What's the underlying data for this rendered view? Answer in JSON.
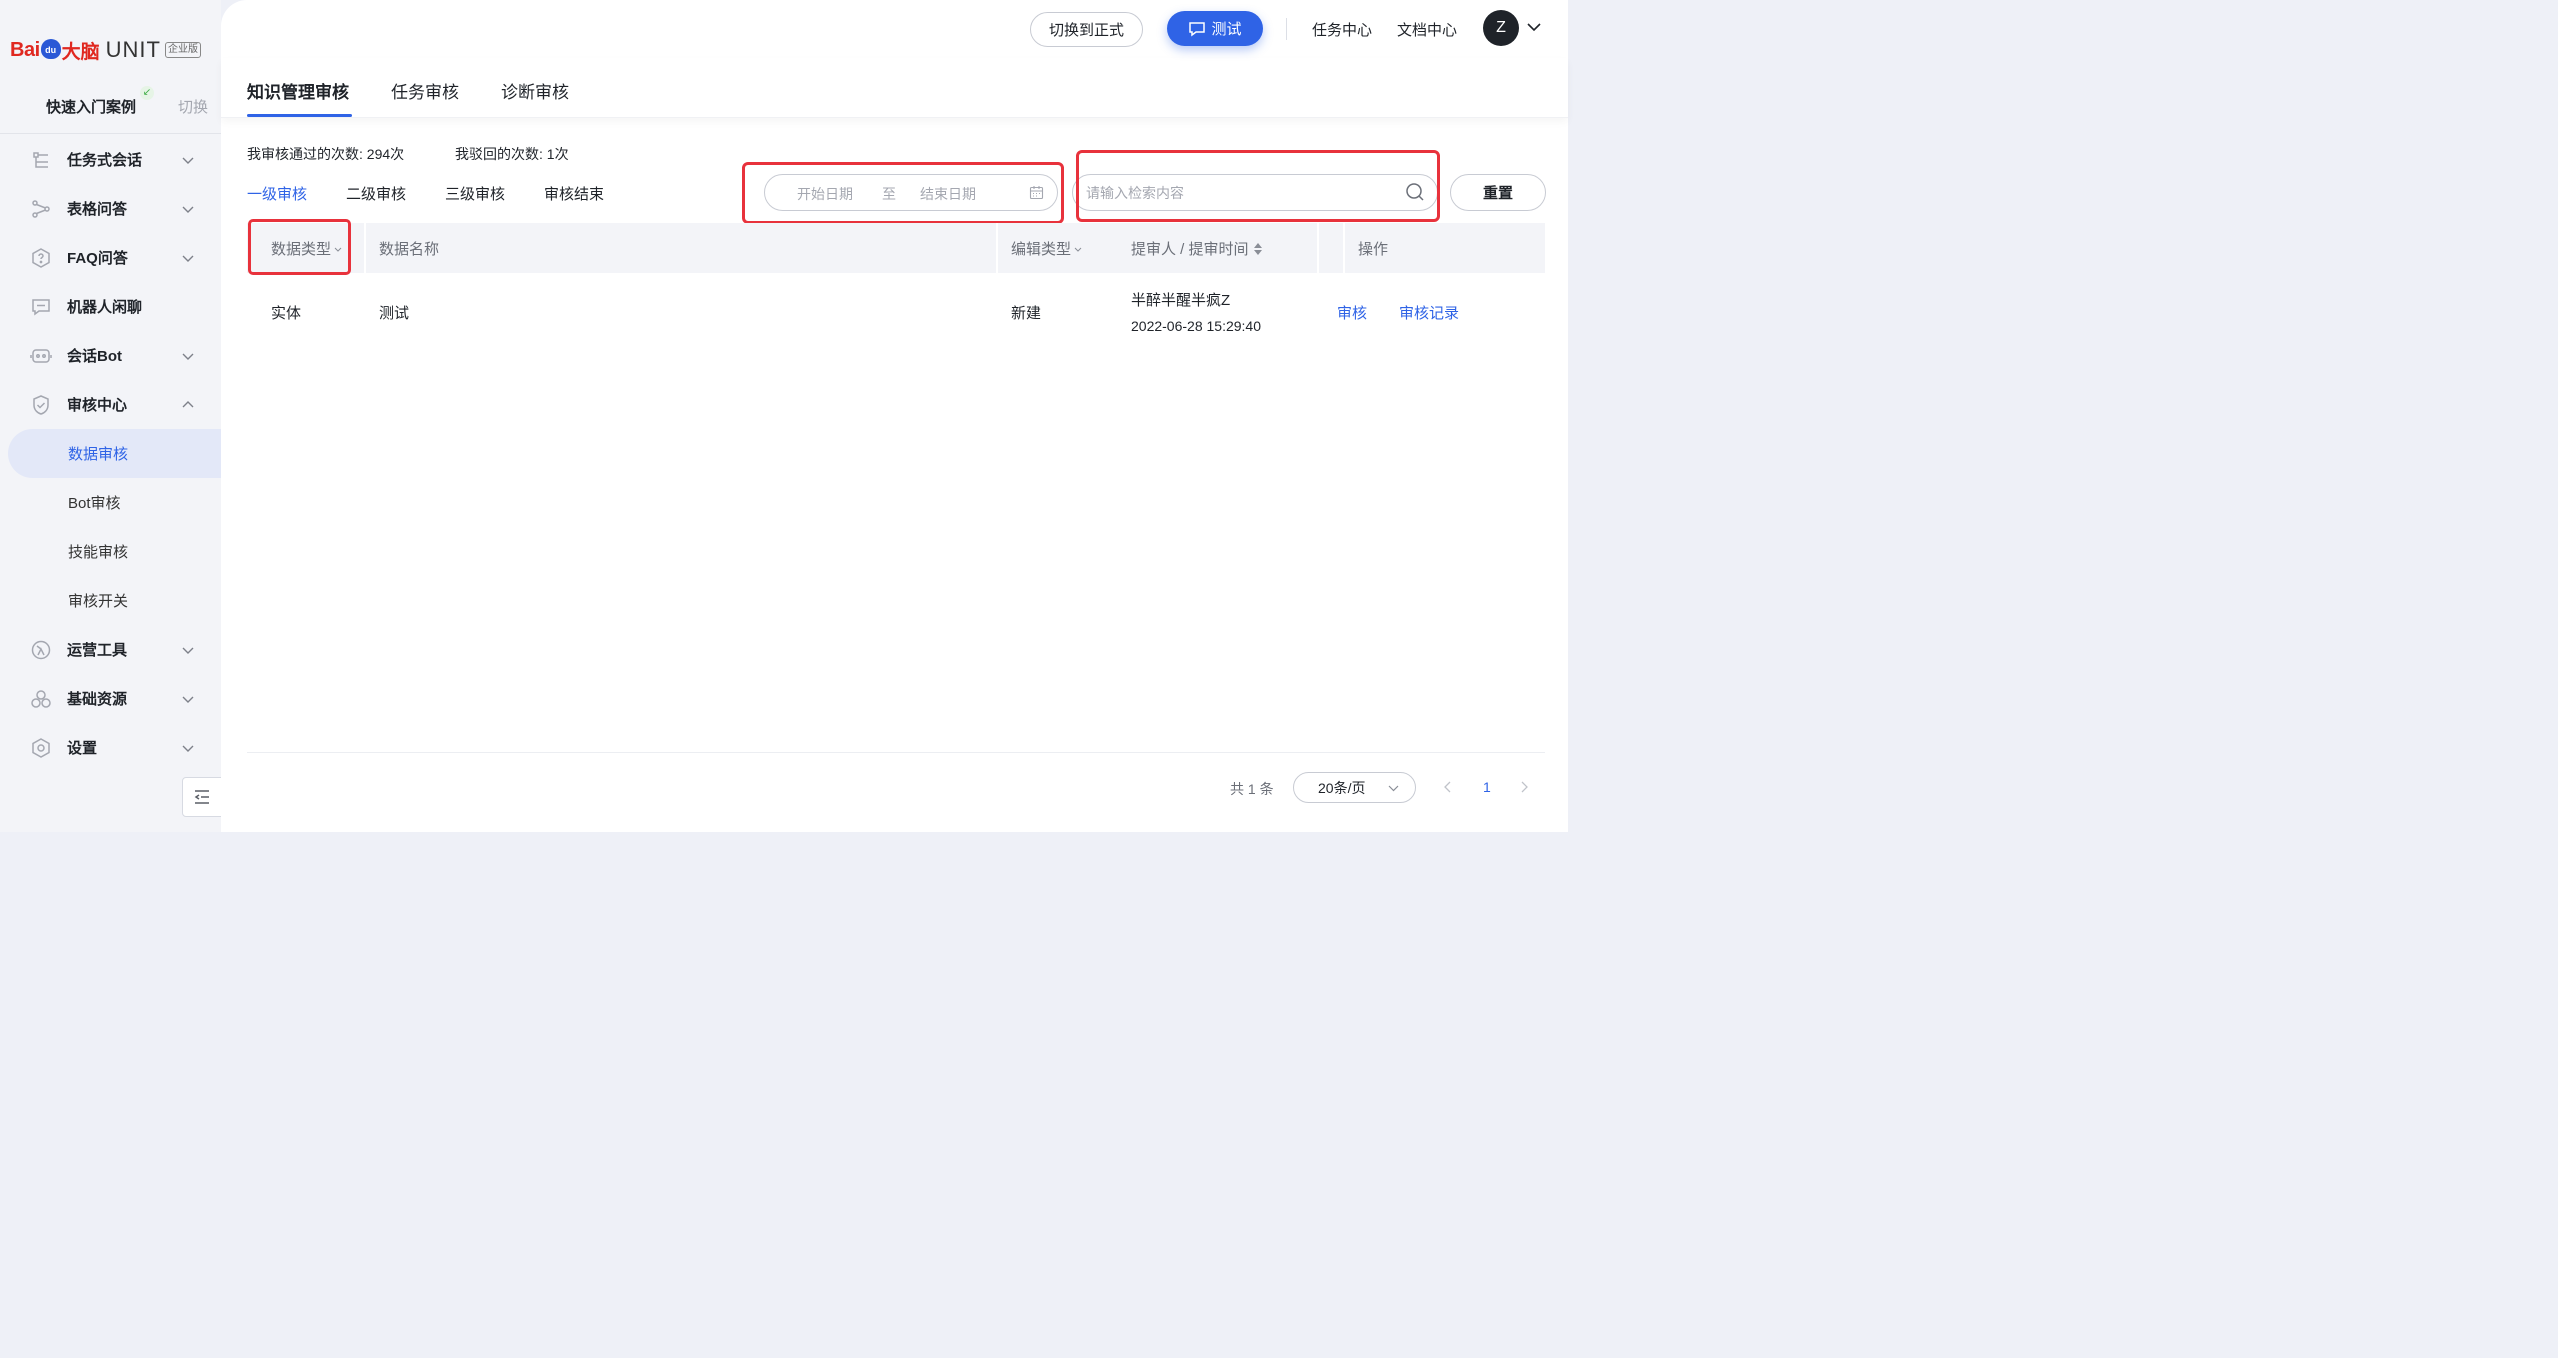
{
  "brand": {
    "baidu": "Bai",
    "du": "du",
    "danao": "大脑",
    "unit": "UNIT",
    "edition": "企业版"
  },
  "sidebar": {
    "case_label": "快速入门案例",
    "switch_label": "切换",
    "items": [
      {
        "label": "任务式会话",
        "icon": "task-dialog-icon",
        "expanded": false
      },
      {
        "label": "表格问答",
        "icon": "table-qa-icon",
        "expanded": false
      },
      {
        "label": "FAQ问答",
        "icon": "faq-icon",
        "expanded": false
      },
      {
        "label": "机器人闲聊",
        "icon": "chat-icon"
      },
      {
        "label": "会话Bot",
        "icon": "bot-icon",
        "expanded": false
      },
      {
        "label": "审核中心",
        "icon": "shield-icon",
        "expanded": true
      },
      {
        "label": "运营工具",
        "icon": "ops-tool-icon",
        "expanded": false
      },
      {
        "label": "基础资源",
        "icon": "resource-icon",
        "expanded": false
      },
      {
        "label": "设置",
        "icon": "settings-icon",
        "expanded": false
      }
    ],
    "sub_items": [
      {
        "label": "数据审核",
        "active": true
      },
      {
        "label": "Bot审核",
        "active": false
      },
      {
        "label": "技能审核",
        "active": false
      },
      {
        "label": "审核开关",
        "active": false
      }
    ]
  },
  "topbar": {
    "switch_formal": "切换到正式",
    "test": "测试",
    "task_center": "任务中心",
    "doc_center": "文档中心",
    "avatar_initial": "Z"
  },
  "tabs": [
    {
      "label": "知识管理审核",
      "active": true
    },
    {
      "label": "任务审核",
      "active": false
    },
    {
      "label": "诊断审核",
      "active": false
    }
  ],
  "stats": {
    "passed": "我审核通过的次数: 294次",
    "rejected": "我驳回的次数: 1次"
  },
  "levels": [
    {
      "label": "一级审核",
      "active": true
    },
    {
      "label": "二级审核",
      "active": false
    },
    {
      "label": "三级审核",
      "active": false
    },
    {
      "label": "审核结束",
      "active": false
    }
  ],
  "filters": {
    "date_start_placeholder": "开始日期",
    "date_sep": "至",
    "date_end_placeholder": "结束日期",
    "search_placeholder": "请输入检索内容",
    "reset": "重置"
  },
  "table": {
    "columns": [
      "数据类型",
      "数据名称",
      "编辑类型",
      "提审人 / 提审时间",
      "操作"
    ],
    "rows": [
      {
        "type": "实体",
        "name": "测试",
        "edit_type": "新建",
        "submitter": "半醉半醒半疯Z",
        "time": "2022-06-28 15:29:40",
        "actions": [
          "审核",
          "审核记录"
        ]
      }
    ]
  },
  "pagination": {
    "total": "共 1 条",
    "page_size": "20条/页",
    "current": "1"
  },
  "colors": {
    "accent": "#2f63e6",
    "highlight": "#e8323c",
    "sidebar_bg": "#f3f4f8"
  }
}
